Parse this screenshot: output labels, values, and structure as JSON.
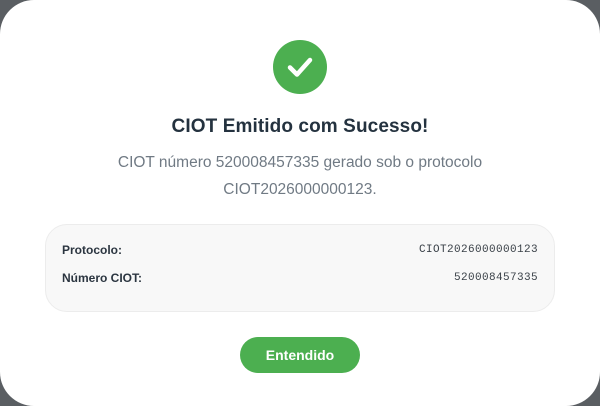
{
  "dialog": {
    "icon": "check-circle-icon",
    "accent_color": "#4caf50",
    "title": "CIOT Emitido com Sucesso!",
    "message": "CIOT número 520008457335 gerado sob o protocolo CIOT2026000000123.",
    "details": [
      {
        "label": "Protocolo:",
        "value": "CIOT2026000000123"
      },
      {
        "label": "Número CIOT:",
        "value": "520008457335"
      }
    ],
    "confirm_label": "Entendido"
  }
}
